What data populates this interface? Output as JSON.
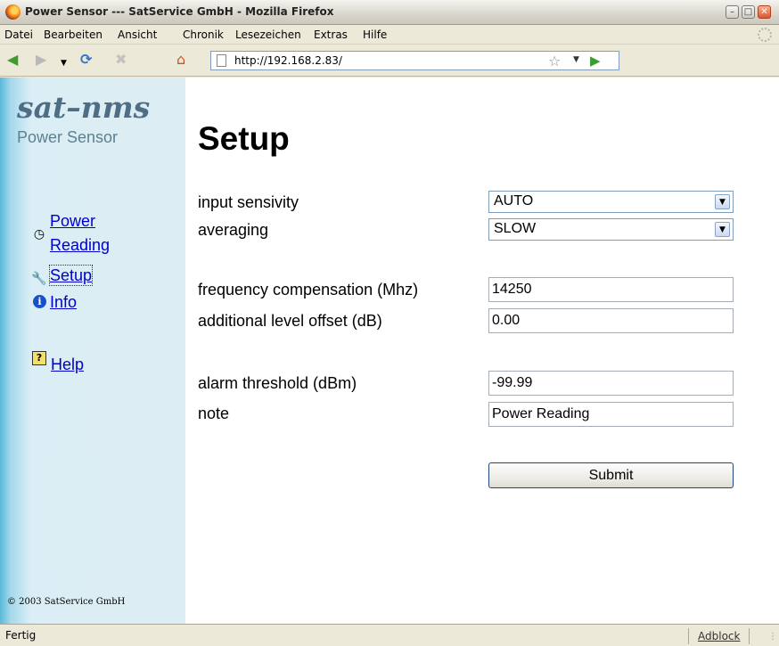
{
  "window": {
    "title": "Power Sensor --- SatService GmbH - Mozilla Firefox"
  },
  "menu": {
    "items": [
      "Datei",
      "Bearbeiten",
      "Ansicht",
      "Chronik",
      "Lesezeichen",
      "Extras",
      "Hilfe"
    ]
  },
  "nav": {
    "url": "http://192.168.2.83/"
  },
  "sidebar": {
    "brand": "sat–nms",
    "subtitle": "Power Sensor",
    "links": {
      "power_reading_1": "Power",
      "power_reading_2": "Reading",
      "setup": "Setup",
      "info": "Info",
      "help": "Help"
    },
    "copyright": "© 2003 SatService GmbH"
  },
  "main": {
    "title": "Setup",
    "fields": {
      "input_sensivity": {
        "label": "input sensivity",
        "value": "AUTO"
      },
      "averaging": {
        "label": "averaging",
        "value": "SLOW"
      },
      "frequency_compensation": {
        "label": "frequency compensation (Mhz)",
        "value": "14250"
      },
      "additional_level_offset": {
        "label": "additional level offset (dB)",
        "value": "0.00"
      },
      "alarm_threshold": {
        "label": "alarm threshold (dBm)",
        "value": "-99.99"
      },
      "note": {
        "label": "note",
        "value": "Power Reading"
      }
    },
    "submit_label": "Submit"
  },
  "status": {
    "text": "Fertig",
    "adblock": "Adblock"
  }
}
